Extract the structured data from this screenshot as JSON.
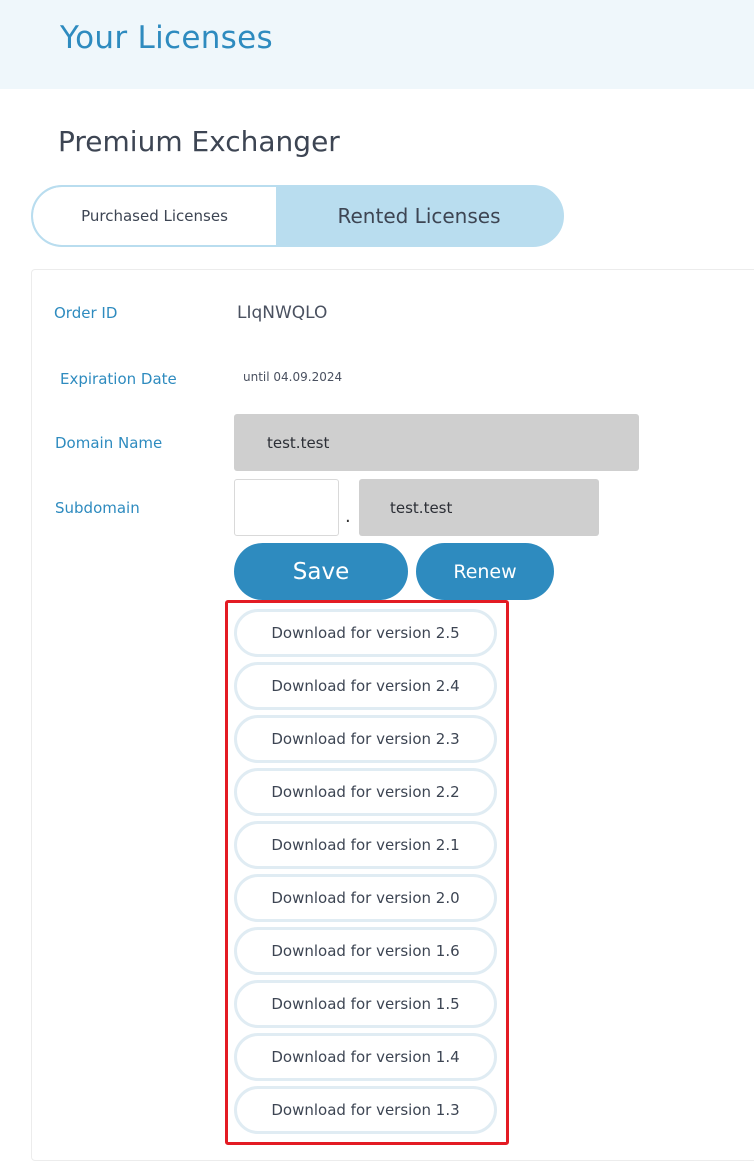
{
  "header": {
    "title": "Your Licenses"
  },
  "section": {
    "title": "Premium Exchanger"
  },
  "tabs": [
    {
      "label": "Purchased Licenses",
      "active": false
    },
    {
      "label": "Rented Licenses",
      "active": true
    }
  ],
  "license": {
    "order_id_label": "Order ID",
    "order_id_value": "LIqNWQLO",
    "expiration_label": "Expiration Date",
    "expiration_value": "until 04.09.2024",
    "domain_label": "Domain Name",
    "domain_value": "test.test",
    "subdomain_label": "Subdomain",
    "subdomain_input_value": "",
    "subdomain_separator": ".",
    "subdomain_domain_value": "test.test"
  },
  "actions": {
    "save_label": "Save",
    "renew_label": "Renew"
  },
  "downloads": [
    {
      "label": "Download for version 2.5"
    },
    {
      "label": "Download for version 2.4"
    },
    {
      "label": "Download for version 2.3"
    },
    {
      "label": "Download for version 2.2"
    },
    {
      "label": "Download for version 2.1"
    },
    {
      "label": "Download for version 2.0"
    },
    {
      "label": "Download for version 1.6"
    },
    {
      "label": "Download for version 1.5"
    },
    {
      "label": "Download for version 1.4"
    },
    {
      "label": "Download for version 1.3"
    }
  ],
  "colors": {
    "accent": "#2e8bbf",
    "tab_active": "#b9ddef",
    "highlight_border": "#e31b23",
    "field_bg": "#cfcfcf"
  }
}
